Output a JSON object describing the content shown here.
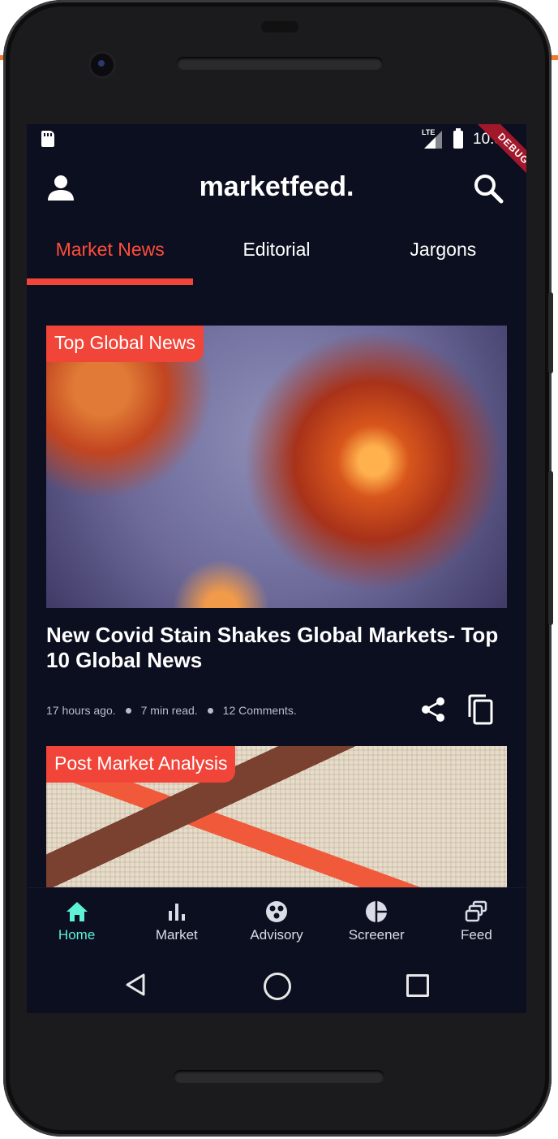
{
  "status_bar": {
    "time": "10:51",
    "network": "LTE",
    "debug_banner": "DEBUG"
  },
  "app_bar": {
    "brand": "marketfeed.",
    "left_icon": "profile-icon",
    "right_icon": "search-icon"
  },
  "tabs": [
    {
      "label": "Market News",
      "active": true
    },
    {
      "label": "Editorial",
      "active": false
    },
    {
      "label": "Jargons",
      "active": false
    }
  ],
  "articles": [
    {
      "tag": "Top Global News",
      "title": "New Covid Stain Shakes Global Markets- Top 10 Global News",
      "time_ago": "17 hours ago.",
      "read_time": "7 min read.",
      "comments": "12 Comments."
    },
    {
      "tag": "Post Market Analysis"
    }
  ],
  "bottom_nav": [
    {
      "label": "Home",
      "icon": "home-icon",
      "active": true
    },
    {
      "label": "Market",
      "icon": "bar-chart-icon",
      "active": false
    },
    {
      "label": "Advisory",
      "icon": "advisory-icon",
      "active": false
    },
    {
      "label": "Screener",
      "icon": "pie-chart-icon",
      "active": false
    },
    {
      "label": "Feed",
      "icon": "feed-icon",
      "active": false
    }
  ],
  "colors": {
    "background": "#0b0f1f",
    "accent": "#f1453a",
    "nav_active": "#5ff0d8"
  }
}
